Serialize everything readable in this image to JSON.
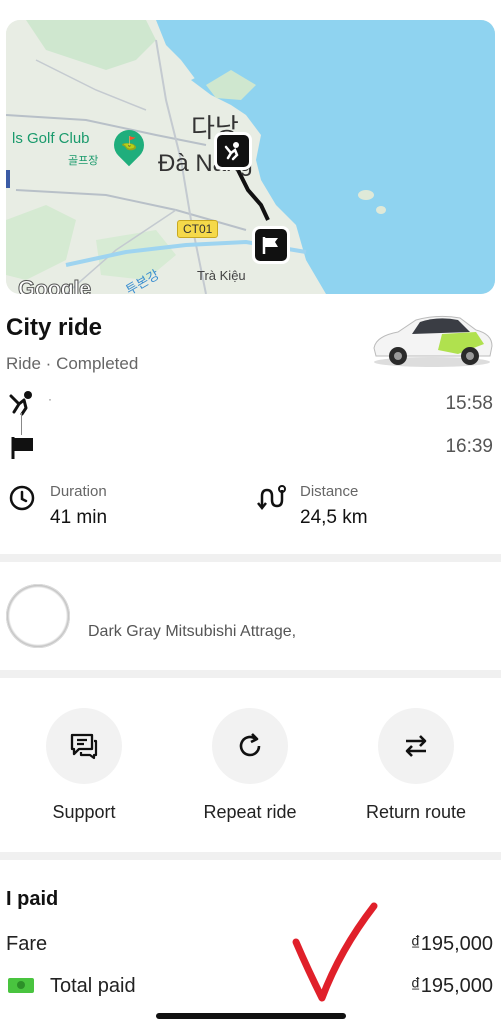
{
  "map": {
    "poi_label": "ls Golf Club",
    "poi_sub": "골프장",
    "city_korean": "다낭",
    "city_vietnamese": "Đà Nẵng",
    "road_badge": "CT01",
    "river_label": "투본강",
    "town_label": "Trà Kiệu",
    "attribution": "Google"
  },
  "ride": {
    "title": "City ride",
    "subtitle": "Ride · Completed",
    "pickup_address": "·",
    "pickup_time": "15:58",
    "dropoff_time": "16:39",
    "duration_label": "Duration",
    "duration_value": "41 min",
    "distance_label": "Distance",
    "distance_value": "24,5 km"
  },
  "vehicle": {
    "description": "Dark Gray Mitsubishi Attrage,"
  },
  "actions": [
    {
      "label": "Support",
      "icon": "chat-icon"
    },
    {
      "label": "Repeat ride",
      "icon": "refresh-icon"
    },
    {
      "label": "Return route",
      "icon": "swap-icon"
    }
  ],
  "payment": {
    "title": "I paid",
    "fare_label": "Fare",
    "fare_value": "₫195,000",
    "total_label": "Total paid",
    "total_value": "₫195,000",
    "payment_method_icon": "cash-icon"
  },
  "colors": {
    "sea": "#8fd3f0",
    "land": "#eaeee8",
    "route": "#111111",
    "accent_green": "#49c43f",
    "annotation_red": "#e0202a"
  }
}
